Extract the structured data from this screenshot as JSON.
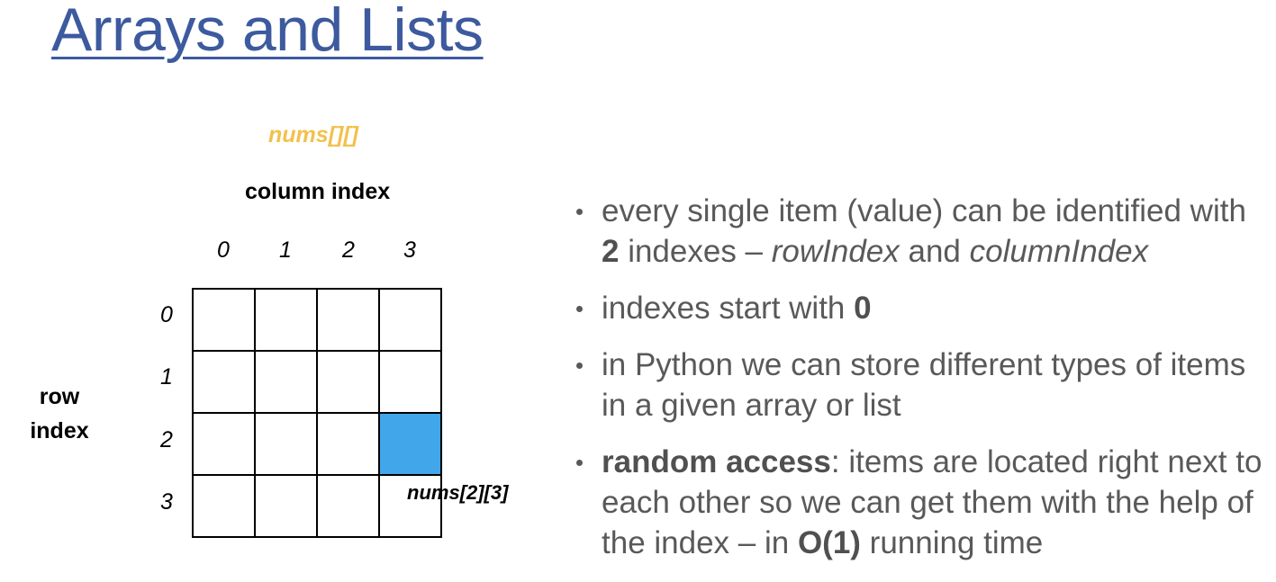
{
  "title": "Arrays and Lists",
  "diagram": {
    "array_name": "nums[][]",
    "column_title": "column index",
    "column_indexes": [
      "0",
      "1",
      "2",
      "3"
    ],
    "row_title_line1": "row",
    "row_title_line2": "index",
    "row_indexes": [
      "0",
      "1",
      "2",
      "3"
    ],
    "grid_rows": 4,
    "grid_cols": 4,
    "highlighted_cell": {
      "row": 2,
      "col": 3
    },
    "highlight_color": "#41a7ea",
    "cell_label": "nums[2][3]"
  },
  "bullets": [
    {
      "t1": "every single item (value) can be identified with ",
      "b1": "2",
      "t2": " indexes – ",
      "i1": "rowIndex",
      "t3": " and ",
      "i2": "columnIndex"
    },
    {
      "t1": "indexes start with ",
      "b1": "0"
    },
    {
      "t1": "in Python we can store different types of items in a given array or list"
    },
    {
      "b1": "random access",
      "t1": ": items are located right next to each other so we can get them with the help of the index – in ",
      "b2": "O(1)",
      "t2": " running time"
    }
  ],
  "colors": {
    "title": "#3d5a9e",
    "array_name": "#f2c14c",
    "bullet_text": "#595959"
  }
}
